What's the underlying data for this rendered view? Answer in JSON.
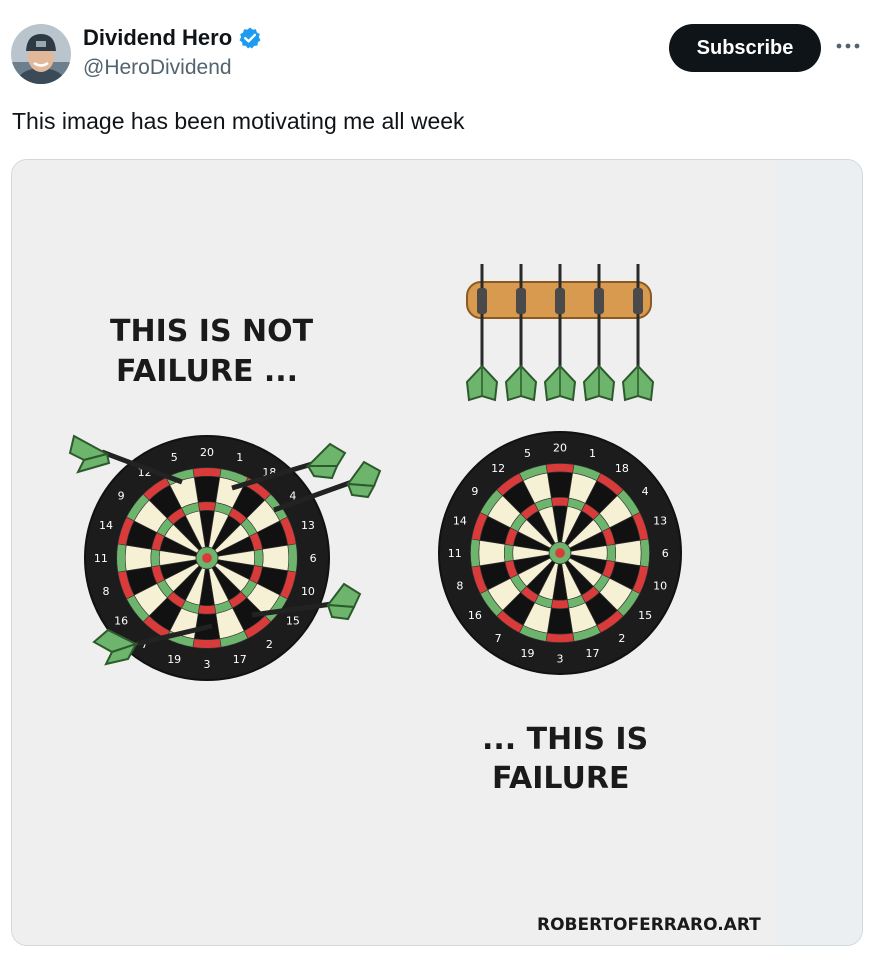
{
  "author": {
    "name": "Dividend Hero",
    "handle": "@HeroDividend",
    "verified": true,
    "verified_color": "#1d9bf0"
  },
  "actions": {
    "subscribe_label": "Subscribe",
    "more_icon": "more-horizontal-icon"
  },
  "tweet": {
    "text": "This image has been motivating me all week"
  },
  "image": {
    "left_caption_line1": "THIS IS NOT",
    "left_caption_line2": "FAILURE ...",
    "right_caption_line1": "... THIS IS",
    "right_caption_line2": "FAILURE",
    "credit": "ROBERTOFERRARO.ART",
    "board_numbers": [
      "20",
      "1",
      "18",
      "4",
      "13",
      "6",
      "10",
      "15",
      "2",
      "17",
      "3",
      "19",
      "7",
      "16",
      "8",
      "11",
      "14",
      "9",
      "12",
      "5"
    ],
    "colors": {
      "background": "#efefef",
      "dart_flight": "#6db56d",
      "dart_grip": "#d89a4e",
      "board_red": "#d93b3b",
      "board_green": "#6db56d",
      "board_cream": "#f6f1d4",
      "board_black": "#111111"
    }
  }
}
